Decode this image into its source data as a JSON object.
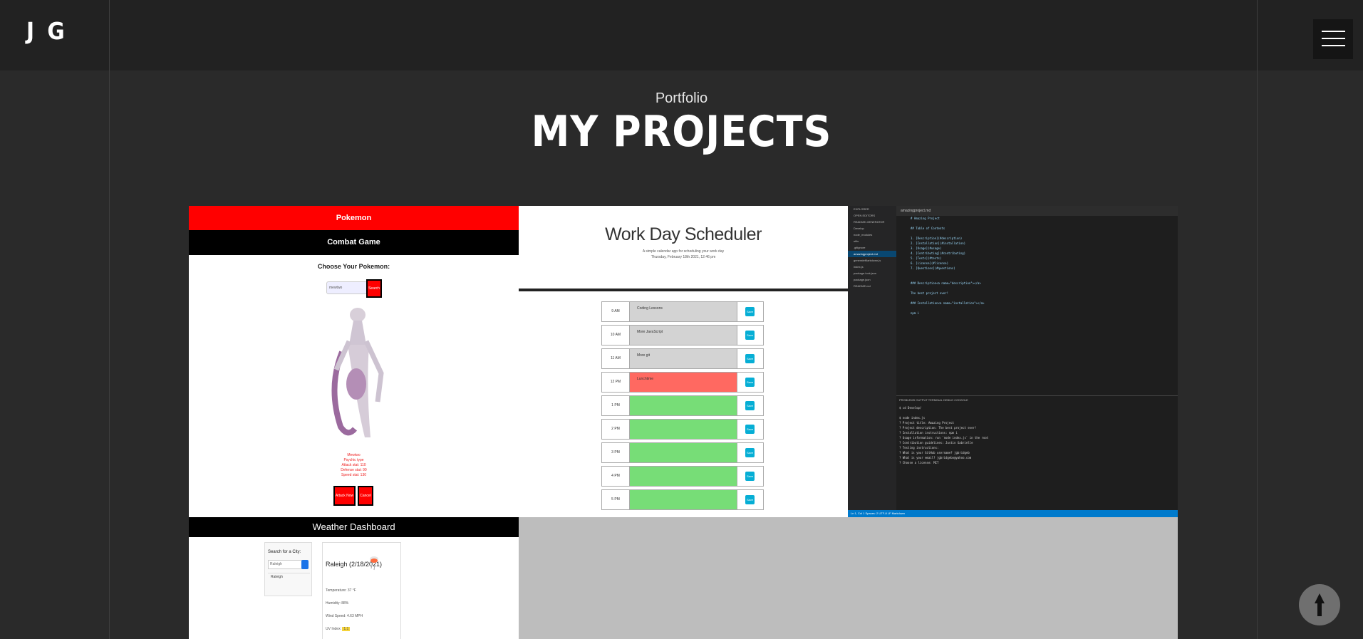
{
  "header": {
    "logo": "J G",
    "menu_icon": "hamburger-icon"
  },
  "section": {
    "kicker": "Portfolio",
    "title": "MY PROJECTS"
  },
  "projects": {
    "pokemon": {
      "title": "Pokemon",
      "subtitle": "Combat Game",
      "prompt": "Choose Your Pokemon:",
      "input_value": "mewtwo",
      "search_label": "Search",
      "stats": [
        "Mewtwo",
        "Psychic type",
        "Attack stat: 110",
        "Defense stat: 90",
        "Speed stat: 130"
      ],
      "attack_label": "Attack Now",
      "cancel_label": "Cancel"
    },
    "scheduler": {
      "title": "Work Day Scheduler",
      "subtitle": "A simple calendar app for scheduling your work day",
      "date": "Thursday, February 18th 2021, 12:46 pm",
      "save_label": "Save",
      "rows": [
        {
          "hour": "9 AM",
          "text": "Coding Lessons",
          "state": "past"
        },
        {
          "hour": "10 AM",
          "text": "More JavaScript",
          "state": "past"
        },
        {
          "hour": "11 AM",
          "text": "More git",
          "state": "past"
        },
        {
          "hour": "12 PM",
          "text": "Lunchtime",
          "state": "present"
        },
        {
          "hour": "1 PM",
          "text": "",
          "state": "future"
        },
        {
          "hour": "2 PM",
          "text": "",
          "state": "future"
        },
        {
          "hour": "3 PM",
          "text": "",
          "state": "future"
        },
        {
          "hour": "4 PM",
          "text": "",
          "state": "future"
        },
        {
          "hour": "5 PM",
          "text": "",
          "state": "future"
        }
      ],
      "colors": {
        "past": "#d3d3d3",
        "present": "#ff6961",
        "future": "#77dd77"
      }
    },
    "readme": {
      "tab": "amazingproject.md",
      "explorer": [
        "EXPLORER",
        "OPEN EDITORS",
        "README-GENERATOR",
        "Develop",
        "node_modules",
        "utils",
        ".gitignore",
        "amazingproject.md",
        "generateMarkdown.js",
        "index.js",
        "package-lock.json",
        "package.json",
        "README.md"
      ],
      "editor": [
        "# Amazing Project",
        "",
        "## Table of Contents",
        "",
        "1. [Description](#description)",
        "2. [Installation](#installation)",
        "3. [Usage](#usage)",
        "4. [Contributing](#contributing)",
        "5. [Tests](#tests)",
        "6. [License](#license)",
        "7. [Questions](#questions)",
        "",
        "",
        "### Description<a name=\"description\"></a>",
        "",
        "The best project ever!",
        "",
        "### Installation<a name=\"installation\"></a>",
        "",
        "npm i"
      ],
      "panel": "PROBLEMS   OUTPUT   TERMINAL   DEBUG CONSOLE",
      "terminal": [
        "$ cd Develop/",
        "",
        "$ node index.js",
        "? Project title: Amazing Project",
        "? Project description: The best project ever!",
        "? Installation instructions: npm i",
        "? Usage information: run `node index.js` in the root",
        "? Contribution guidelines: Justin Gabrielle",
        "? Testing instructions:",
        "? What is your GitHub username? jgbridgeb",
        "? What is your email? jgbridgebo@yahoo.com",
        "? Choose a license: MIT"
      ],
      "status": "Ln 1, Col 1   Spaces: 2   UTF-8   LF   Markdown"
    },
    "weather": {
      "title": "Weather Dashboard",
      "search_label": "Search for a City:",
      "input_value": "Raleigh",
      "history": [
        "Raleigh"
      ],
      "city": "Raleigh (2/18/2021)",
      "details": [
        "Temperature: 37 °F",
        "Humidity: 88%",
        "Wind Speed: 4.63 MPH",
        "UV Index:"
      ],
      "uv": "1.1"
    }
  },
  "ui": {
    "top_button_icon": "arrow-up-icon"
  }
}
